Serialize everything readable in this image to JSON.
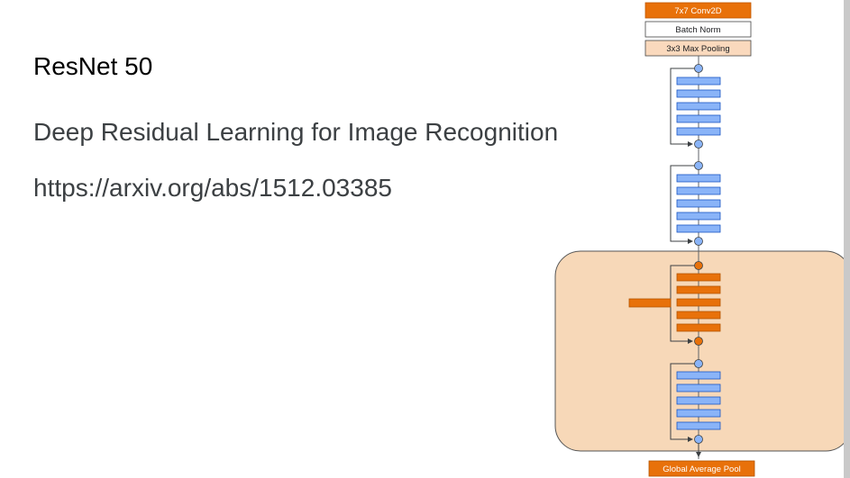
{
  "slide": {
    "title": "ResNet 50",
    "subtitle": "Deep Residual Learning for Image Recognition",
    "link": "https://arxiv.org/abs/1512.03385"
  },
  "diagram": {
    "top_blocks": [
      {
        "label": "7x7 Conv2D",
        "style": "orange"
      },
      {
        "label": "Batch Norm",
        "style": "white"
      },
      {
        "label": "3x3 Max Pooling",
        "style": "peach"
      }
    ],
    "stages": [
      {
        "layers": 6,
        "color": "blue",
        "highlighted": false
      },
      {
        "layers": 6,
        "color": "blue",
        "highlighted": false
      },
      {
        "layers": 6,
        "color": "orange",
        "highlighted": true
      },
      {
        "layers": 6,
        "color": "blue",
        "highlighted": true
      }
    ],
    "bottom_block": {
      "label": "Global Average Pool"
    },
    "colors": {
      "orange": "#e8710a",
      "blue": "#8ab4f8",
      "peach": "#fad9bd",
      "highlight": "#f7d8b8",
      "connector": "#5f6368"
    }
  }
}
